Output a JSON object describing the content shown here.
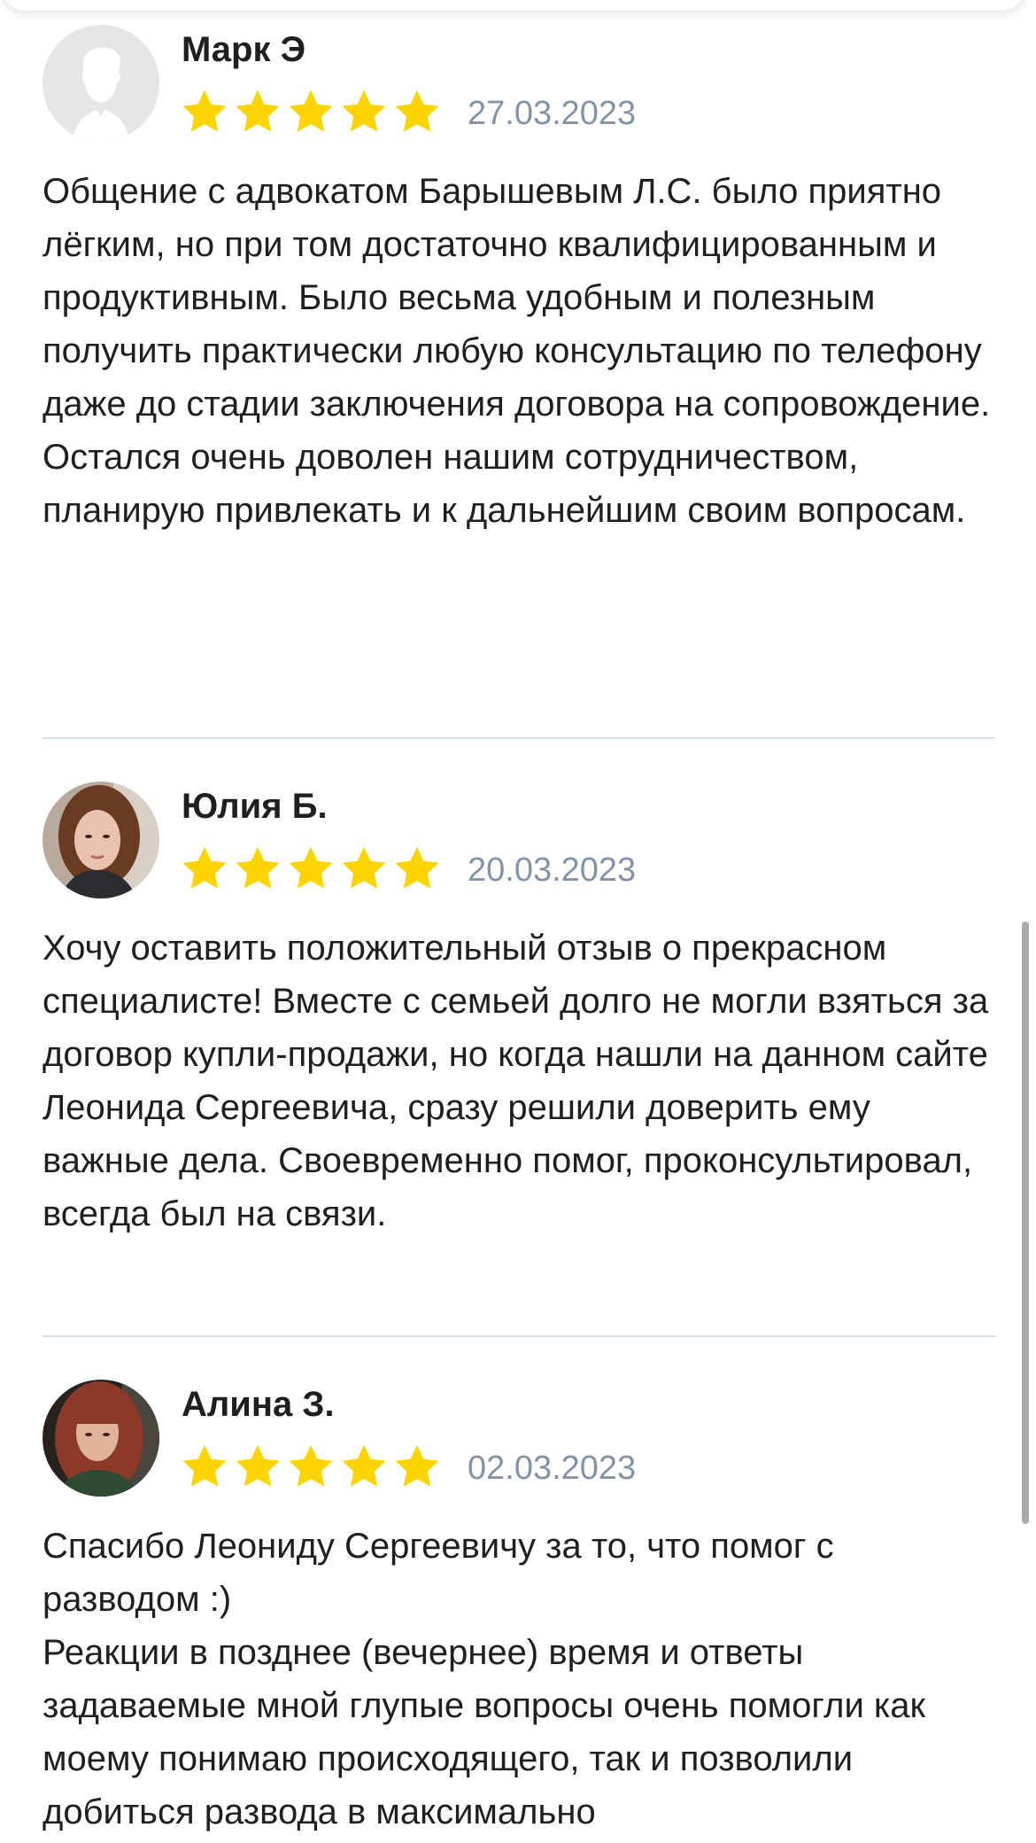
{
  "reviews": [
    {
      "author": "Марк Э",
      "rating": 5,
      "date": "27.03.2023",
      "avatar": "default-avatar-icon",
      "text": "Общение с адвокатом Барышевым Л.С. было приятно лёгким, но при том достаточно квалифицированным и продуктивным. Было весьма удобным и полезным получить практически любую консультацию по телефону даже до стадии заключения договора на сопровождение.\nОстался очень доволен нашим сотрудничеством, планирую привлекать и к дальнейшим своим вопросам."
    },
    {
      "author": "Юлия Б.",
      "rating": 5,
      "date": "20.03.2023",
      "avatar": "user-photo",
      "text": "Хочу оставить положительный отзыв о прекрасном специалисте! Вместе с семьей долго не могли взяться за договор купли-продажи, но когда нашли на данном сайте Леонида Сергеевича, сразу решили доверить ему важные дела. Своевременно помог, проконсультировал, всегда был на связи."
    },
    {
      "author": "Алина З.",
      "rating": 5,
      "date": "02.03.2023",
      "avatar": "user-photo",
      "text": "Спасибо Леониду Сергеевичу за то, что помог с разводом :)\nРеакции в позднее (вечернее) время и ответы задаваемые мной глупые вопросы очень помогли как моему понимаю происходящего, так и позволили добиться развода в максимально"
    }
  ],
  "colors": {
    "star": "#fcd400",
    "date": "#8393a7",
    "divider": "#d6dfe6",
    "text": "#1f1f1f"
  }
}
